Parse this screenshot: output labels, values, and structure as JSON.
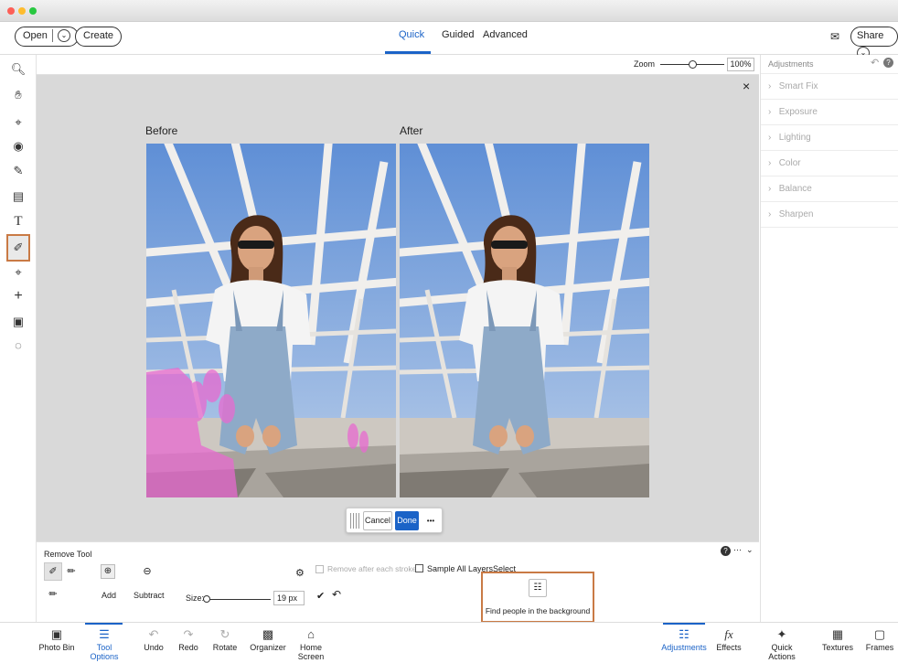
{
  "header": {
    "open_label": "Open",
    "create_label": "Create",
    "tabs": [
      "Quick",
      "Guided",
      "Advanced"
    ],
    "share_label": "Share"
  },
  "zoom": {
    "label": "Zoom",
    "value": "100%",
    "level_fraction": 0.5
  },
  "canvas": {
    "before_label": "Before",
    "after_label": "After"
  },
  "commit": {
    "cancel_label": "Cancel",
    "done_label": "Done",
    "more_label": "•••"
  },
  "adjustments": {
    "title": "Adjustments",
    "items": [
      "Smart Fix",
      "Exposure",
      "Lighting",
      "Color",
      "Balance",
      "Sharpen"
    ]
  },
  "tool_options": {
    "tool_name": "Remove Tool",
    "add_label": "Add",
    "subtract_label": "Subtract",
    "size_label": "Size:",
    "size_value": "19 px",
    "remove_after_label": "Remove after each stroke",
    "sample_all_label": "Sample All Layers",
    "select_label": "Select",
    "find_people_label": "Find people in the background"
  },
  "bottom_left": [
    "Photo Bin",
    "Tool Options",
    "Undo",
    "Redo",
    "Rotate",
    "Organizer",
    "Home Screen"
  ],
  "bottom_right": [
    "Adjustments",
    "Effects",
    "Quick Actions",
    "Textures",
    "Frames"
  ],
  "colors": {
    "accent": "#1b63c7",
    "highlight": "#c97a45",
    "mask": "#e86ad0"
  }
}
